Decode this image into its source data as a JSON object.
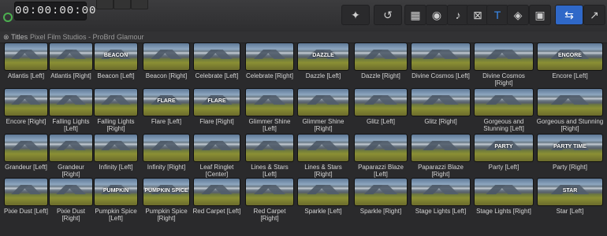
{
  "toolbar": {
    "timecode": "00:00:00:00",
    "tools": [
      {
        "name": "enhance-wand-icon",
        "glyph": "✦"
      },
      {
        "name": "retime-icon",
        "glyph": "↺"
      },
      {
        "name": "clip-appearance-icon",
        "glyph": "▦"
      },
      {
        "name": "camera-icon",
        "glyph": "◉"
      },
      {
        "name": "music-note-icon",
        "glyph": "♪"
      },
      {
        "name": "transitions-icon",
        "glyph": "⊠"
      },
      {
        "name": "titles-icon",
        "glyph": "T"
      },
      {
        "name": "generators-icon",
        "glyph": "◈"
      },
      {
        "name": "themes-icon",
        "glyph": "▣"
      },
      {
        "name": "inspector-toggle-icon",
        "glyph": "⇆"
      },
      {
        "name": "share-icon",
        "glyph": "↗"
      }
    ]
  },
  "header": {
    "close_glyph": "⊗",
    "title": "Titles",
    "path": "Pixel Film Studios - ProBrd Glamour"
  },
  "titles": [
    {
      "label": "Atlantis [Left]",
      "cap": ""
    },
    {
      "label": "Atlantis [Right]",
      "cap": ""
    },
    {
      "label": "Beacon [Left]",
      "cap": "BEACON"
    },
    {
      "label": "Beacon [Right]",
      "cap": ""
    },
    {
      "label": "Celebrate [Left]",
      "cap": ""
    },
    {
      "label": "Celebrate [Right]",
      "cap": ""
    },
    {
      "label": "Dazzle [Left]",
      "cap": "DAZZLE"
    },
    {
      "label": "Dazzle [Right]",
      "cap": ""
    },
    {
      "label": "Divine Cosmos [Left]",
      "cap": ""
    },
    {
      "label": "Divine Cosmos [Right]",
      "cap": ""
    },
    {
      "label": "Encore [Left]",
      "cap": "ENCORE"
    },
    {
      "label": "Encore [Right]",
      "cap": ""
    },
    {
      "label": "Falling Lights [Left]",
      "cap": ""
    },
    {
      "label": "Falling Lights [Right]",
      "cap": ""
    },
    {
      "label": "Flare [Left]",
      "cap": "FLARE"
    },
    {
      "label": "Flare [Right]",
      "cap": "FLARE"
    },
    {
      "label": "Glimmer Shine [Left]",
      "cap": ""
    },
    {
      "label": "Glimmer Shine [Right]",
      "cap": ""
    },
    {
      "label": "Glitz [Left]",
      "cap": ""
    },
    {
      "label": "Glitz [Right]",
      "cap": ""
    },
    {
      "label": "Gorgeous and Stunning [Left]",
      "cap": ""
    },
    {
      "label": "Gorgeous and Stunning [Right]",
      "cap": ""
    },
    {
      "label": "Grandeur [Left]",
      "cap": ""
    },
    {
      "label": "Grandeur [Right]",
      "cap": ""
    },
    {
      "label": "Infinity [Left]",
      "cap": ""
    },
    {
      "label": "Infinity [Right]",
      "cap": ""
    },
    {
      "label": "Leaf Ringlet [Center]",
      "cap": ""
    },
    {
      "label": "Lines & Stars [Left]",
      "cap": ""
    },
    {
      "label": "Lines & Stars [Right]",
      "cap": ""
    },
    {
      "label": "Paparazzi Blaze [Left]",
      "cap": ""
    },
    {
      "label": "Paparazzi Blaze [Right]",
      "cap": ""
    },
    {
      "label": "Party [Left]",
      "cap": "PARTY"
    },
    {
      "label": "Party [Right]",
      "cap": "PARTY TIME"
    },
    {
      "label": "Pixie Dust [Left]",
      "cap": ""
    },
    {
      "label": "Pixie Dust [Right]",
      "cap": ""
    },
    {
      "label": "Pumpkin Spice [Left]",
      "cap": "PUMPKIN"
    },
    {
      "label": "Pumpkin Spice [Right]",
      "cap": "PUMPKIN SPICE"
    },
    {
      "label": "Red Carpet [Left]",
      "cap": ""
    },
    {
      "label": "Red Carpet [Right]",
      "cap": ""
    },
    {
      "label": "Sparkle [Left]",
      "cap": ""
    },
    {
      "label": "Sparkle [Right]",
      "cap": ""
    },
    {
      "label": "Stage Lights [Left]",
      "cap": ""
    },
    {
      "label": "Stage Lights [Right]",
      "cap": ""
    },
    {
      "label": "Star [Left]",
      "cap": "STAR"
    }
  ]
}
